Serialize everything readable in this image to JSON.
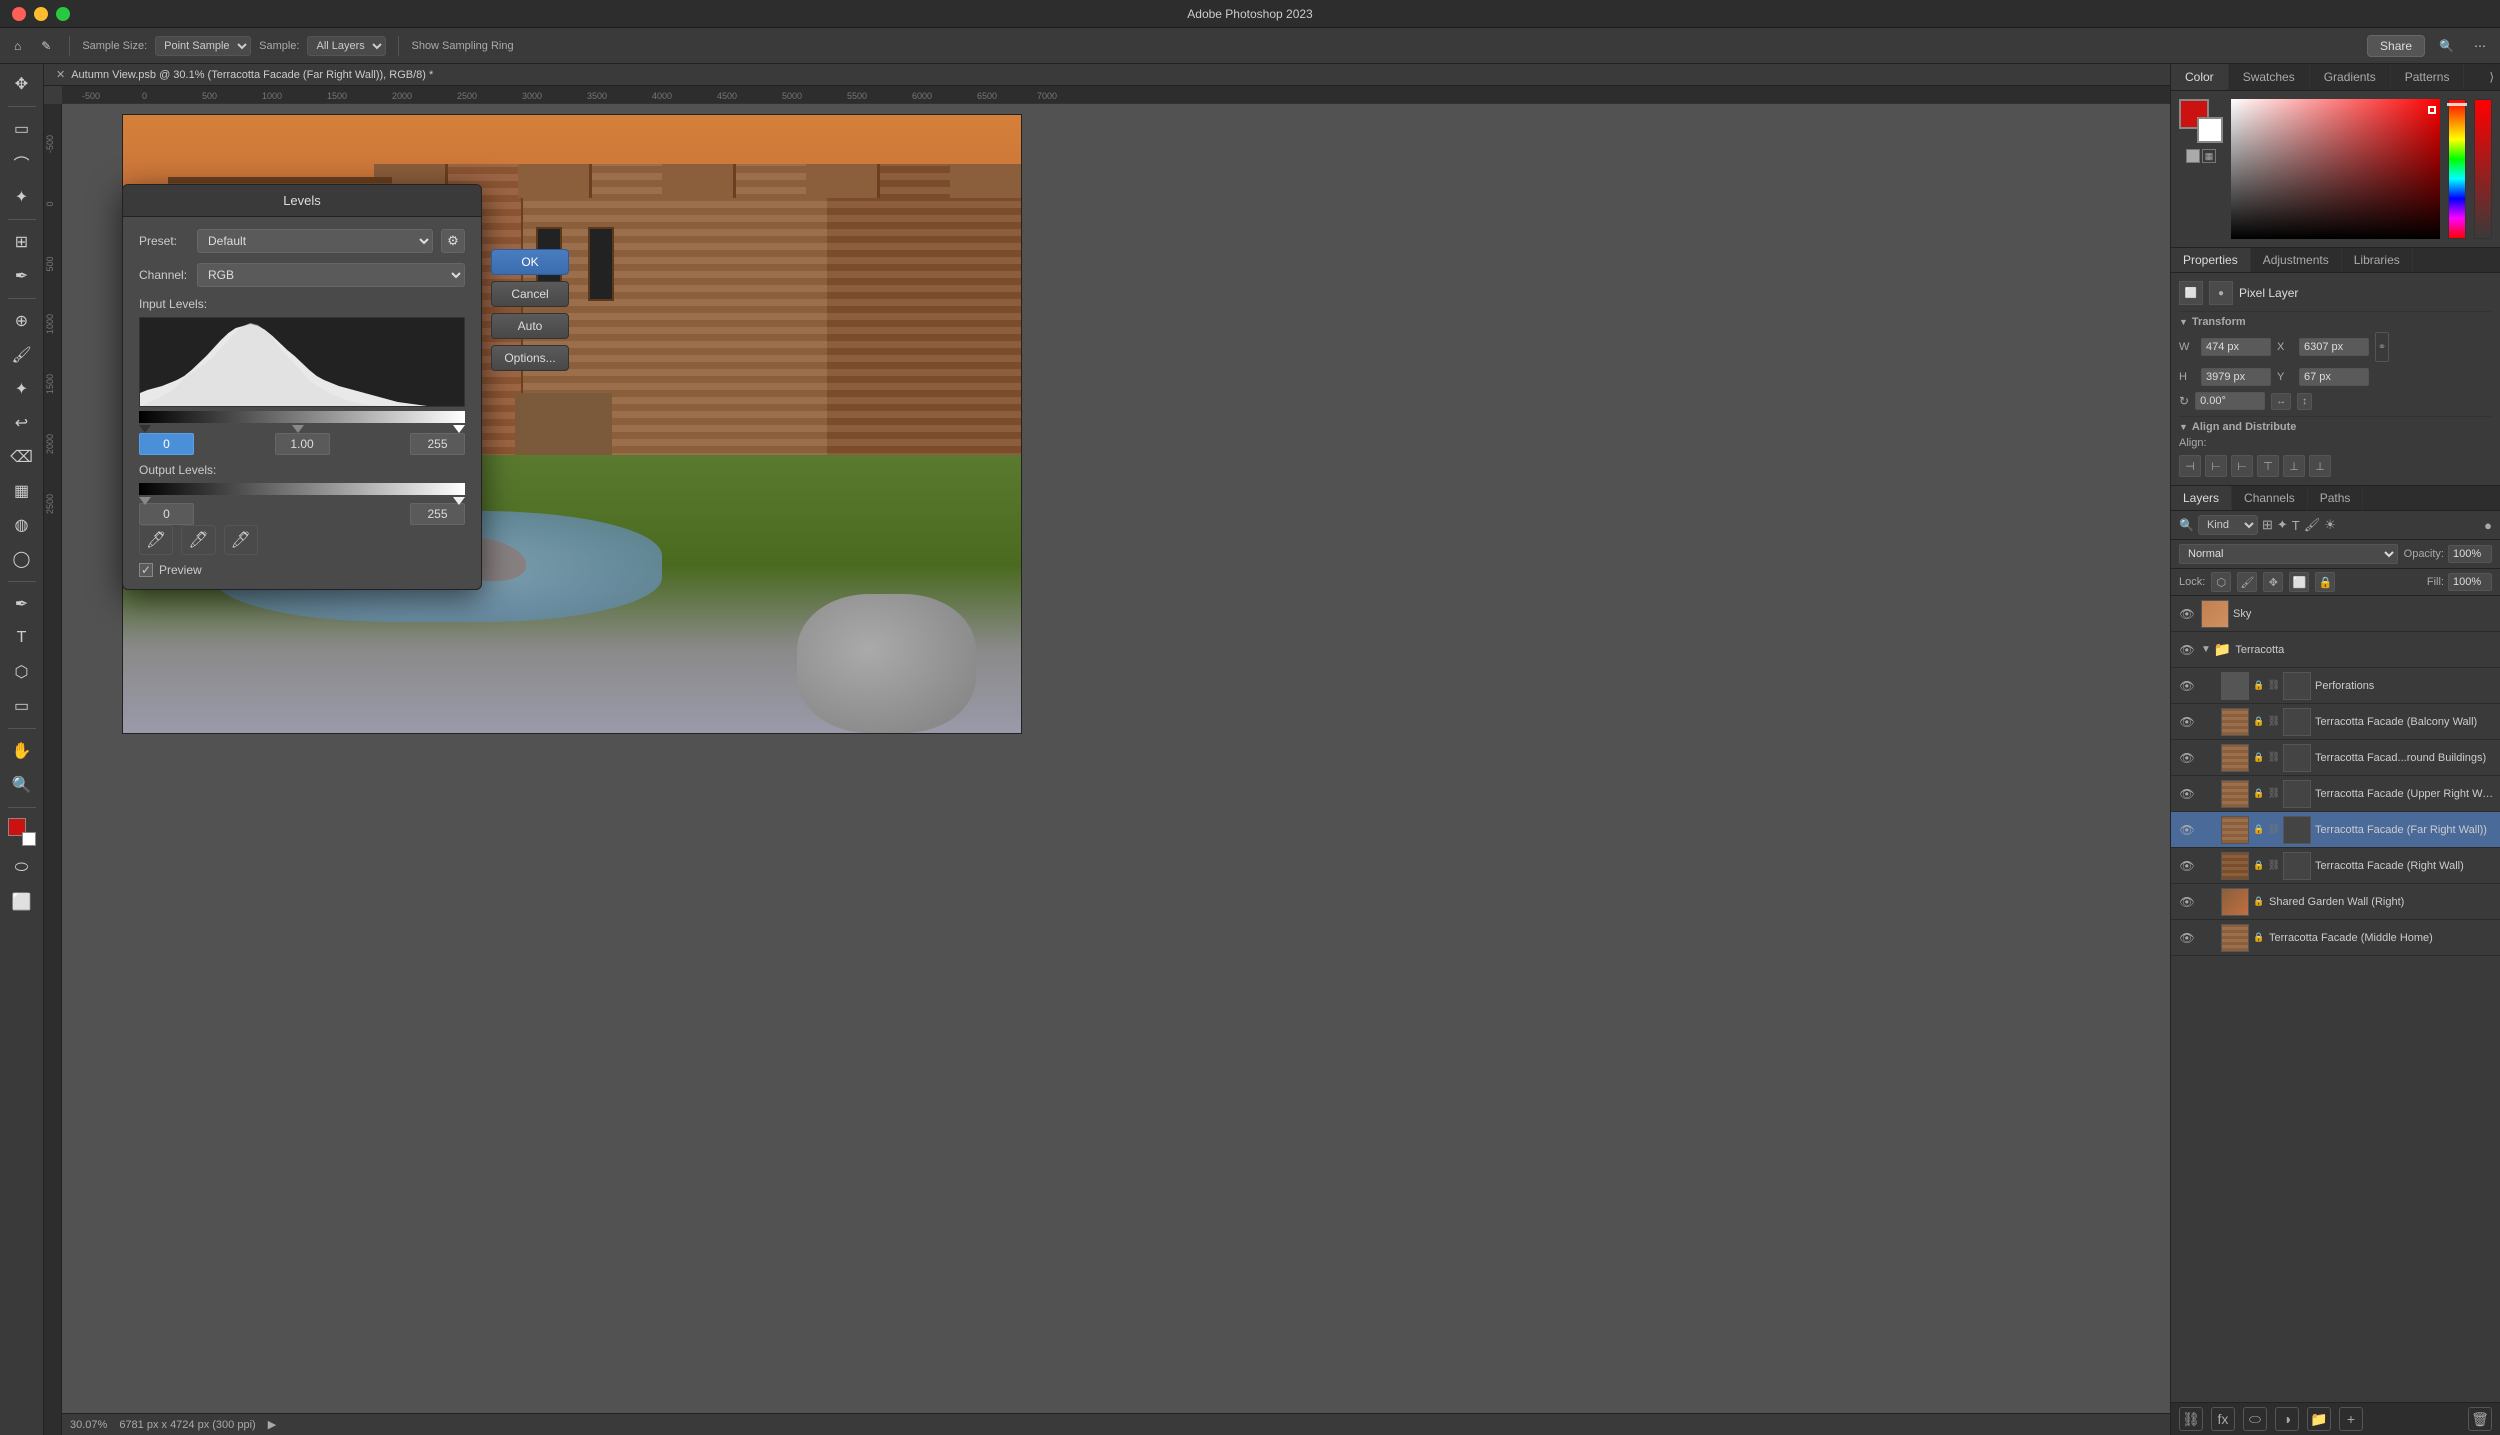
{
  "app": {
    "title": "Adobe Photoshop 2023",
    "window_title": "Autumn View.psb @ 30.1% (Terracotta Facade (Far Right Wall)), RGB/8) *"
  },
  "titlebar": {
    "traffic": [
      "close",
      "minimize",
      "maximize"
    ]
  },
  "top_toolbar": {
    "tool_icon": "✎",
    "sample_size_label": "Sample Size:",
    "sample_size_value": "Point Sample",
    "sample_label": "Sample:",
    "sample_value": "All Layers",
    "show_sampling": "Show Sampling Ring",
    "share_label": "Share"
  },
  "context_toolbar": {
    "sample_size_label": "Sample Size:",
    "sample_size_value": "Point Sample",
    "sample_label": "Sample:",
    "sample_value": "All Layers",
    "show_sampling_label": "Show Sampling Ring"
  },
  "levels_dialog": {
    "title": "Levels",
    "preset_label": "Preset:",
    "preset_value": "Default",
    "channel_label": "Channel:",
    "channel_value": "RGB",
    "input_levels_label": "Input Levels:",
    "input_min": "0",
    "input_mid": "1.00",
    "input_max": "255",
    "output_levels_label": "Output Levels:",
    "output_min": "0",
    "output_max": "255",
    "btn_ok": "OK",
    "btn_cancel": "Cancel",
    "btn_auto": "Auto",
    "btn_options": "Options...",
    "preview_label": "Preview",
    "preview_checked": true
  },
  "color_panel": {
    "tabs": [
      "Color",
      "Swatches",
      "Gradients",
      "Patterns"
    ],
    "active_tab": "Color",
    "swatches_tab": "Swatches"
  },
  "properties_panel": {
    "tabs": [
      "Properties",
      "Adjustments",
      "Libraries"
    ],
    "active_tab": "Properties",
    "pixel_layer_label": "Pixel Layer",
    "transform_label": "Transform",
    "w_label": "W",
    "w_value": "474 px",
    "h_label": "H",
    "h_value": "3979 px",
    "x_label": "X",
    "x_value": "6307 px",
    "y_label": "Y",
    "y_value": "67 px",
    "rotation_value": "0.00°",
    "align_label": "Align and Distribute",
    "align_sub": "Align:"
  },
  "layers_panel": {
    "tabs": [
      "Layers",
      "Channels",
      "Paths"
    ],
    "active_tab": "Layers",
    "blend_mode": "Normal",
    "opacity_label": "Opacity:",
    "opacity_value": "100%",
    "lock_label": "Lock:",
    "fill_label": "Fill:",
    "fill_value": "100%",
    "search_placeholder": "Kind",
    "layers": [
      {
        "name": "Sky",
        "type": "pixel",
        "visible": true,
        "thumb_class": "thumb-sky",
        "indent": 0
      },
      {
        "name": "Terracotta",
        "type": "group",
        "visible": true,
        "thumb_class": "thumb-terracotta",
        "indent": 0,
        "expanded": true
      },
      {
        "name": "Perforations",
        "type": "pixel",
        "visible": true,
        "thumb_class": "thumb-dark",
        "indent": 1,
        "has_mask": true,
        "has_lock": true
      },
      {
        "name": "Terracotta Facade (Balcony Wall)",
        "type": "pixel",
        "visible": true,
        "thumb_class": "thumb-terracotta",
        "indent": 1,
        "has_mask": true,
        "has_lock": true
      },
      {
        "name": "Terracotta Facad...round Buildings)",
        "type": "pixel",
        "visible": true,
        "thumb_class": "thumb-terracotta",
        "indent": 1,
        "has_mask": true,
        "has_lock": true
      },
      {
        "name": "Terracotta Facade (Upper Right Wall)",
        "type": "pixel",
        "visible": true,
        "thumb_class": "thumb-terracotta",
        "indent": 1,
        "has_mask": true,
        "has_lock": true
      },
      {
        "name": "Terracotta Facade (Far Right Wall))",
        "type": "pixel",
        "visible": true,
        "thumb_class": "thumb-terracotta",
        "indent": 1,
        "has_mask": true,
        "has_lock": true,
        "active": true
      },
      {
        "name": "Terracotta Facade (Right Wall)",
        "type": "pixel",
        "visible": true,
        "thumb_class": "thumb-terracotta",
        "indent": 1,
        "has_mask": true,
        "has_lock": true
      },
      {
        "name": "Shared Garden Wall (Right)",
        "type": "pixel",
        "visible": true,
        "thumb_class": "thumb-gradient",
        "indent": 1,
        "has_lock": true
      },
      {
        "name": "Terracotta Facade (Middle Home)",
        "type": "pixel",
        "visible": true,
        "thumb_class": "thumb-terracotta",
        "indent": 1,
        "has_lock": true
      }
    ]
  },
  "canvas": {
    "status_zoom": "30.07%",
    "status_size": "6781 px x 4724 px (300 ppi)"
  },
  "ruler": {
    "marks": [
      "-500",
      "0",
      "500",
      "1000",
      "1500",
      "2000",
      "2500",
      "3000",
      "3500",
      "4000",
      "4500",
      "5000",
      "5500",
      "6000",
      "6500",
      "7000"
    ]
  }
}
